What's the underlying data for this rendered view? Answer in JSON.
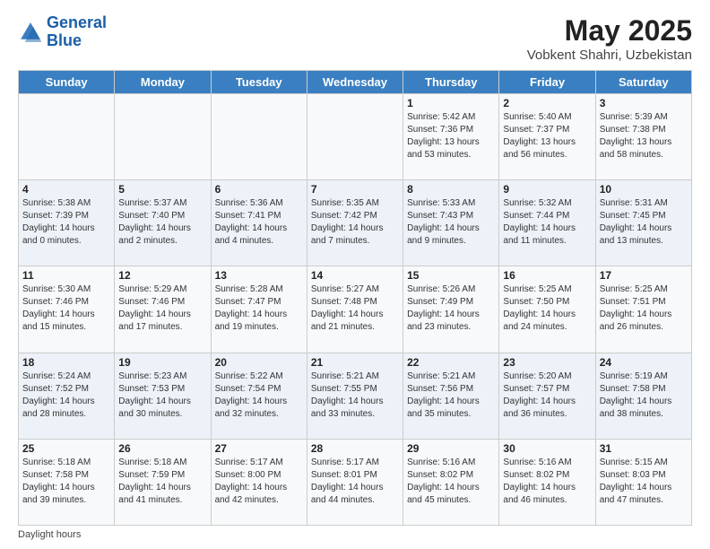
{
  "logo": {
    "line1": "General",
    "line2": "Blue"
  },
  "title": "May 2025",
  "subtitle": "Vobkent Shahri, Uzbekistan",
  "days_of_week": [
    "Sunday",
    "Monday",
    "Tuesday",
    "Wednesday",
    "Thursday",
    "Friday",
    "Saturday"
  ],
  "weeks": [
    [
      {
        "num": "",
        "info": ""
      },
      {
        "num": "",
        "info": ""
      },
      {
        "num": "",
        "info": ""
      },
      {
        "num": "",
        "info": ""
      },
      {
        "num": "1",
        "info": "Sunrise: 5:42 AM\nSunset: 7:36 PM\nDaylight: 13 hours\nand 53 minutes."
      },
      {
        "num": "2",
        "info": "Sunrise: 5:40 AM\nSunset: 7:37 PM\nDaylight: 13 hours\nand 56 minutes."
      },
      {
        "num": "3",
        "info": "Sunrise: 5:39 AM\nSunset: 7:38 PM\nDaylight: 13 hours\nand 58 minutes."
      }
    ],
    [
      {
        "num": "4",
        "info": "Sunrise: 5:38 AM\nSunset: 7:39 PM\nDaylight: 14 hours\nand 0 minutes."
      },
      {
        "num": "5",
        "info": "Sunrise: 5:37 AM\nSunset: 7:40 PM\nDaylight: 14 hours\nand 2 minutes."
      },
      {
        "num": "6",
        "info": "Sunrise: 5:36 AM\nSunset: 7:41 PM\nDaylight: 14 hours\nand 4 minutes."
      },
      {
        "num": "7",
        "info": "Sunrise: 5:35 AM\nSunset: 7:42 PM\nDaylight: 14 hours\nand 7 minutes."
      },
      {
        "num": "8",
        "info": "Sunrise: 5:33 AM\nSunset: 7:43 PM\nDaylight: 14 hours\nand 9 minutes."
      },
      {
        "num": "9",
        "info": "Sunrise: 5:32 AM\nSunset: 7:44 PM\nDaylight: 14 hours\nand 11 minutes."
      },
      {
        "num": "10",
        "info": "Sunrise: 5:31 AM\nSunset: 7:45 PM\nDaylight: 14 hours\nand 13 minutes."
      }
    ],
    [
      {
        "num": "11",
        "info": "Sunrise: 5:30 AM\nSunset: 7:46 PM\nDaylight: 14 hours\nand 15 minutes."
      },
      {
        "num": "12",
        "info": "Sunrise: 5:29 AM\nSunset: 7:46 PM\nDaylight: 14 hours\nand 17 minutes."
      },
      {
        "num": "13",
        "info": "Sunrise: 5:28 AM\nSunset: 7:47 PM\nDaylight: 14 hours\nand 19 minutes."
      },
      {
        "num": "14",
        "info": "Sunrise: 5:27 AM\nSunset: 7:48 PM\nDaylight: 14 hours\nand 21 minutes."
      },
      {
        "num": "15",
        "info": "Sunrise: 5:26 AM\nSunset: 7:49 PM\nDaylight: 14 hours\nand 23 minutes."
      },
      {
        "num": "16",
        "info": "Sunrise: 5:25 AM\nSunset: 7:50 PM\nDaylight: 14 hours\nand 24 minutes."
      },
      {
        "num": "17",
        "info": "Sunrise: 5:25 AM\nSunset: 7:51 PM\nDaylight: 14 hours\nand 26 minutes."
      }
    ],
    [
      {
        "num": "18",
        "info": "Sunrise: 5:24 AM\nSunset: 7:52 PM\nDaylight: 14 hours\nand 28 minutes."
      },
      {
        "num": "19",
        "info": "Sunrise: 5:23 AM\nSunset: 7:53 PM\nDaylight: 14 hours\nand 30 minutes."
      },
      {
        "num": "20",
        "info": "Sunrise: 5:22 AM\nSunset: 7:54 PM\nDaylight: 14 hours\nand 32 minutes."
      },
      {
        "num": "21",
        "info": "Sunrise: 5:21 AM\nSunset: 7:55 PM\nDaylight: 14 hours\nand 33 minutes."
      },
      {
        "num": "22",
        "info": "Sunrise: 5:21 AM\nSunset: 7:56 PM\nDaylight: 14 hours\nand 35 minutes."
      },
      {
        "num": "23",
        "info": "Sunrise: 5:20 AM\nSunset: 7:57 PM\nDaylight: 14 hours\nand 36 minutes."
      },
      {
        "num": "24",
        "info": "Sunrise: 5:19 AM\nSunset: 7:58 PM\nDaylight: 14 hours\nand 38 minutes."
      }
    ],
    [
      {
        "num": "25",
        "info": "Sunrise: 5:18 AM\nSunset: 7:58 PM\nDaylight: 14 hours\nand 39 minutes."
      },
      {
        "num": "26",
        "info": "Sunrise: 5:18 AM\nSunset: 7:59 PM\nDaylight: 14 hours\nand 41 minutes."
      },
      {
        "num": "27",
        "info": "Sunrise: 5:17 AM\nSunset: 8:00 PM\nDaylight: 14 hours\nand 42 minutes."
      },
      {
        "num": "28",
        "info": "Sunrise: 5:17 AM\nSunset: 8:01 PM\nDaylight: 14 hours\nand 44 minutes."
      },
      {
        "num": "29",
        "info": "Sunrise: 5:16 AM\nSunset: 8:02 PM\nDaylight: 14 hours\nand 45 minutes."
      },
      {
        "num": "30",
        "info": "Sunrise: 5:16 AM\nSunset: 8:02 PM\nDaylight: 14 hours\nand 46 minutes."
      },
      {
        "num": "31",
        "info": "Sunrise: 5:15 AM\nSunset: 8:03 PM\nDaylight: 14 hours\nand 47 minutes."
      }
    ]
  ],
  "footer": "Daylight hours"
}
